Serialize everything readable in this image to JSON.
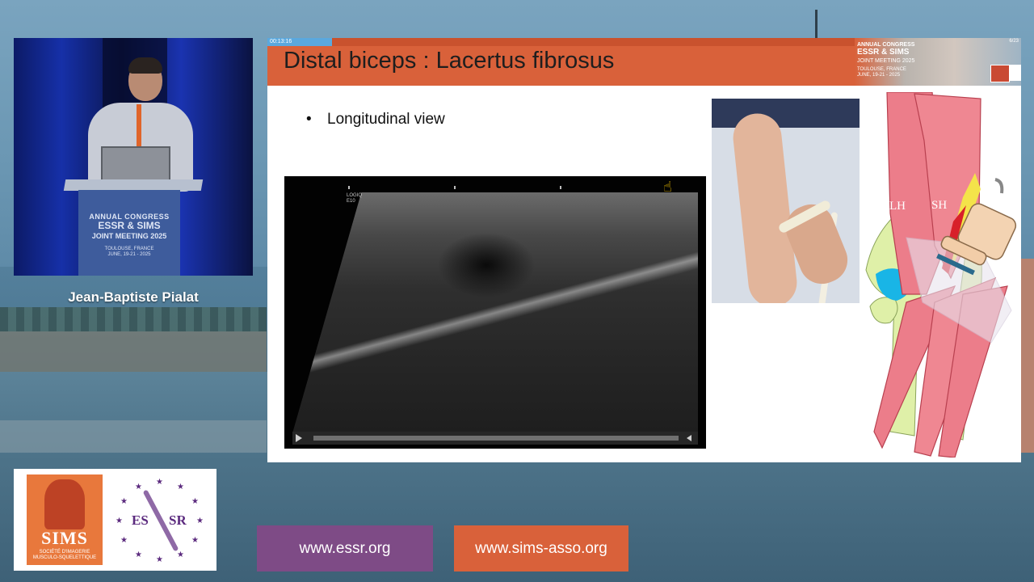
{
  "speaker": {
    "name": "Jean-Baptiste Pialat",
    "podium": {
      "line1": "ANNUAL CONGRESS",
      "line2": "ESSR & SIMS",
      "line3": "JOINT MEETING 2025",
      "line4": "TOULOUSE, FRANCE",
      "line5": "JUNE, 19-21 - 2025"
    }
  },
  "slide": {
    "timer": "00:13:16",
    "progress_percent": 11,
    "title": "Distal biceps : Lacertus fibrosus",
    "bullet": "Longitudinal view",
    "banner": {
      "line1": "ANNUAL CONGRESS",
      "line2": "ESSR & SIMS",
      "line3": "JOINT MEETING 2025",
      "line4": "TOULOUSE, FRANCE",
      "line5": "JUNE, 19-21 - 2025",
      "page": "6/23"
    },
    "ultrasound": {
      "logo_line1": "LOGIQ",
      "logo_line2": "E10"
    },
    "anatomy": {
      "label_lh": "LH",
      "label_sh": "SH"
    }
  },
  "footer": {
    "sims_logo_text": "SIMS",
    "sims_logo_sub1": "SOCIÉTÉ D'IMAGERIE",
    "sims_logo_sub2": "MUSCULO-SQUELETTIQUE",
    "essr_logo_left": "ES",
    "essr_logo_right": "SR",
    "url_essr": "www.essr.org",
    "url_sims": "www.sims-asso.org"
  },
  "colors": {
    "header_orange": "#d9613a",
    "progress_blue": "#5aa8de",
    "essr_purple": "#7e4b86"
  },
  "icons": {
    "cursor": "hand-pointer-icon",
    "play": "play-icon"
  }
}
